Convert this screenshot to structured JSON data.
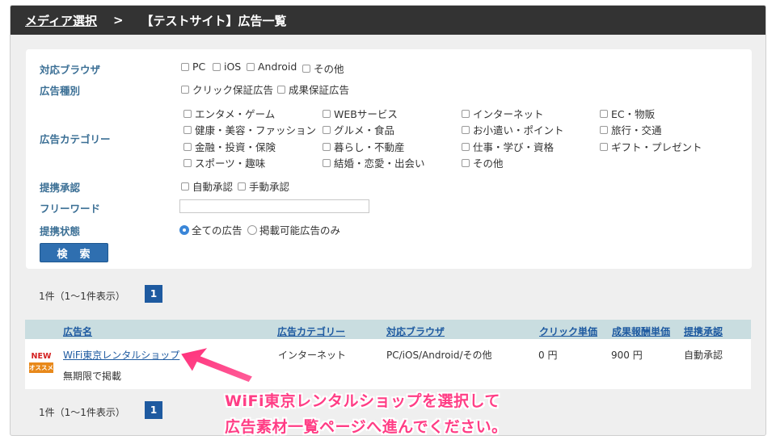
{
  "breadcrumb": {
    "media_select": "メディア選択",
    "separator": ">",
    "current": "【テストサイト】広告一覧"
  },
  "filters": {
    "browser": {
      "label": "対応ブラウザ",
      "options": [
        "PC",
        "iOS",
        "Android",
        "その他"
      ]
    },
    "ad_type": {
      "label": "広告種別",
      "options": [
        "クリック保証広告",
        "成果保証広告"
      ]
    },
    "category": {
      "label": "広告カテゴリー",
      "options": [
        "エンタメ・ゲーム",
        "WEBサービス",
        "インターネット",
        "EC・物販",
        "健康・美容・ファッション",
        "グルメ・食品",
        "お小遣い・ポイント",
        "旅行・交通",
        "金融・投資・保険",
        "暮らし・不動産",
        "仕事・学び・資格",
        "ギフト・プレゼント",
        "スポーツ・趣味",
        "結婚・恋愛・出会い",
        "その他"
      ]
    },
    "approval": {
      "label": "提携承認",
      "options": [
        "自動承認",
        "手動承認"
      ]
    },
    "freeword": {
      "label": "フリーワード",
      "value": ""
    },
    "status": {
      "label": "提携状態",
      "options": [
        "全ての広告",
        "掲載可能広告のみ"
      ],
      "selected": "全ての広告"
    },
    "search_label": "検　索"
  },
  "results": {
    "count_text": "1件（1〜1件表示）",
    "current_page": "1",
    "columns": [
      "広告名",
      "広告カテゴリー",
      "対応ブラウザ",
      "クリック単価",
      "成果報酬単価",
      "提携承認"
    ],
    "rows": [
      {
        "badge_new": "NEW",
        "badge_recommend": "オススメ",
        "name": "WiFi東京レンタルショップ",
        "period": "無期限で掲載",
        "category": "インターネット",
        "browser": "PC/iOS/Android/その他",
        "click_price": "0 円",
        "reward_price": "900 円",
        "approval": "自動承認"
      }
    ]
  },
  "callout": {
    "line1": "WiFi東京レンタルショップを選択して",
    "line2": "広告素材一覧ページへ進んでください。"
  },
  "colors": {
    "topbar": "#333333",
    "accent_blue": "#1e5aa0",
    "label_blue": "#3b6f95",
    "callout_pink": "#ff3d85",
    "table_header": "#c9dde0"
  }
}
